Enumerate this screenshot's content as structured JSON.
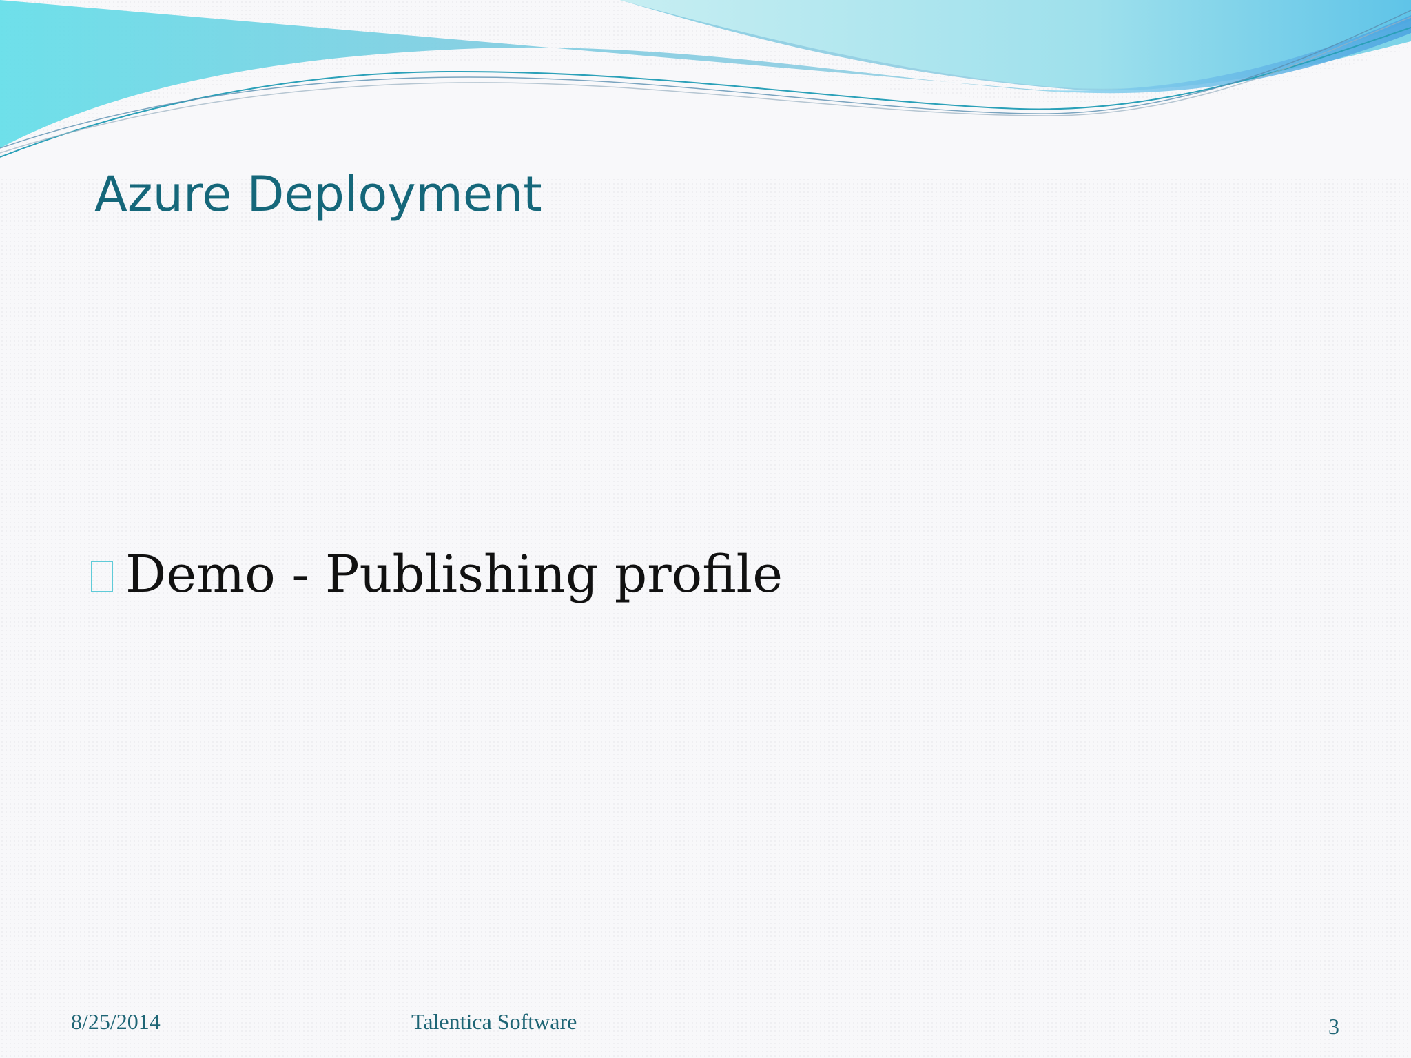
{
  "slide": {
    "title": "Azure Deployment",
    "bullets": [
      {
        "text": "Demo - Publishing profile"
      }
    ],
    "footer": {
      "date": "8/25/2014",
      "company": "Talentica Software",
      "page_number": "3"
    }
  },
  "colors": {
    "title": "#15677a",
    "bullet_marker": "#5fcbd8",
    "body_text": "#111111",
    "footer_text": "#1e6575",
    "wave_light": "#a8e4ec",
    "wave_mid": "#6fd4e4",
    "wave_dark": "#4aa8d0",
    "background": "#f8f8fa"
  },
  "icons": {
    "bullet": "square-bullet-icon"
  }
}
